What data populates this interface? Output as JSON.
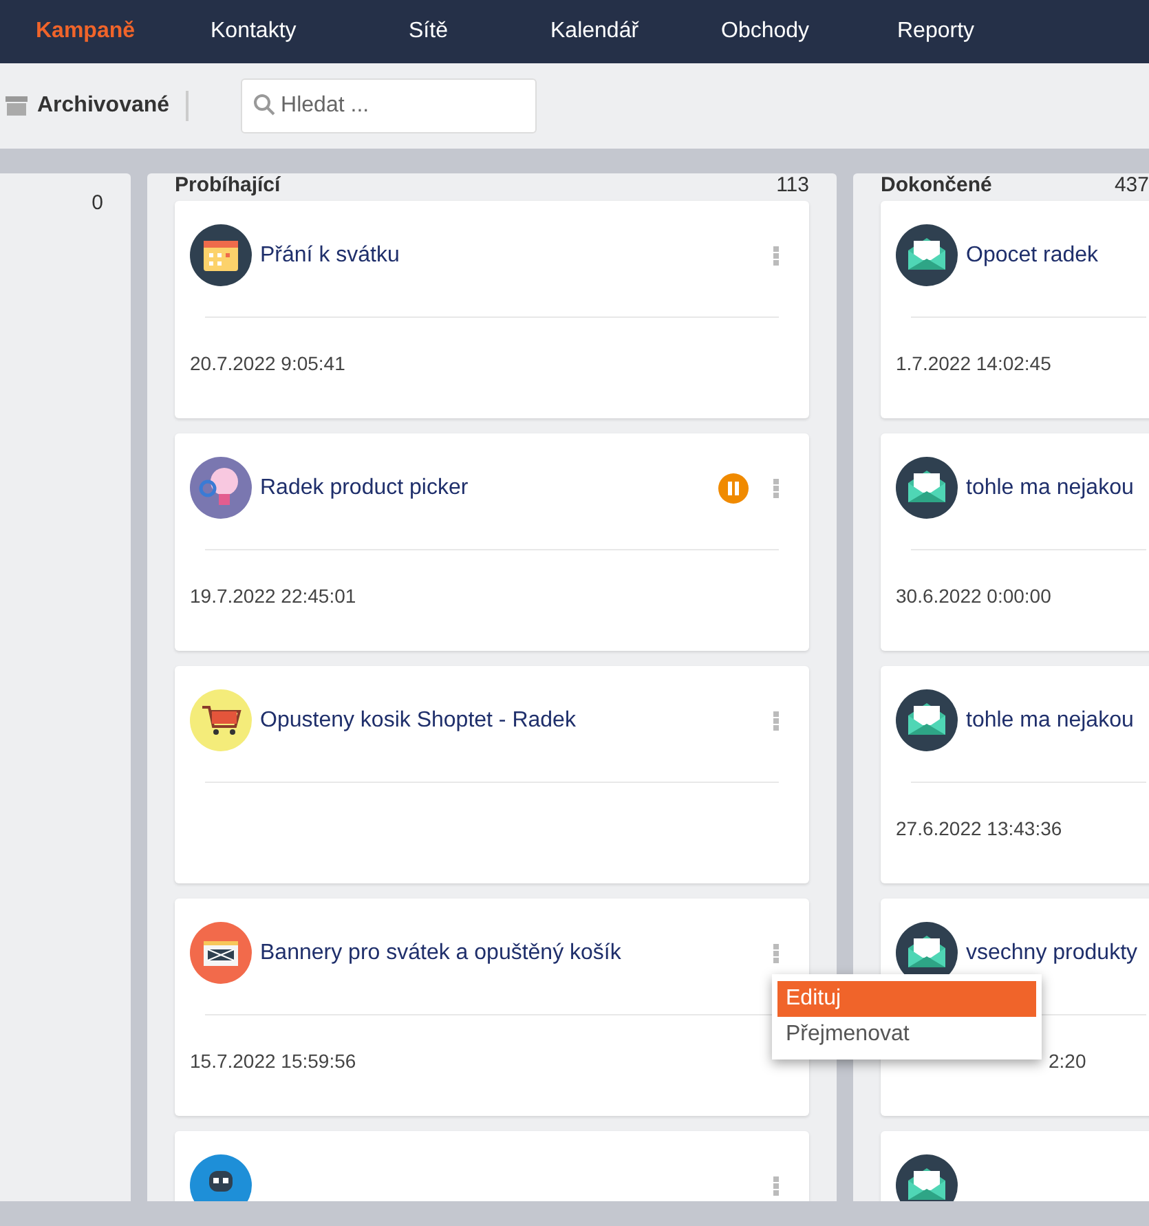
{
  "nav": [
    {
      "label": "Kampaně",
      "selected": true
    },
    {
      "label": "Kontakty",
      "selected": false
    },
    {
      "label": "Sítě",
      "selected": false
    },
    {
      "label": "Kalendář",
      "selected": false
    },
    {
      "label": "Obchody",
      "selected": false
    },
    {
      "label": "Reporty",
      "selected": false
    }
  ],
  "toolbar": {
    "archive_label": "Archivované",
    "search": {
      "placeholder": "Hledat ..."
    }
  },
  "columns": [
    {
      "count": "0"
    },
    {
      "title": "Probíhající",
      "count": "113",
      "cards": [
        {
          "title": "Přání k svátku",
          "date": "20.7.2022 9:05:41",
          "paused": false
        },
        {
          "title": "Radek product picker",
          "date": "19.7.2022 22:45:01",
          "paused": true
        },
        {
          "title": "Opusteny kosik Shoptet - Radek",
          "paused": false
        },
        {
          "title": "Bannery pro svátek a opuštěný košík",
          "date": "15.7.2022 15:59:56",
          "paused": false,
          "menu": [
            {
              "label": "Edituj",
              "selected": true
            },
            {
              "label": "Přejmenovat",
              "selected": false
            }
          ]
        },
        {
          "paused": false
        }
      ]
    },
    {
      "title": "Dokončené",
      "count": "437",
      "cards": [
        {
          "title": "Opocet radek",
          "date": "1.7.2022 14:02:45",
          "paused": false
        },
        {
          "title": "tohle ma nejakou",
          "date": "30.6.2022 0:00:00",
          "paused": false
        },
        {
          "title": "tohle ma nejakou",
          "date": "27.6.2022 13:43:36",
          "paused": false
        },
        {
          "title": "vsechny produkty",
          "date": "2:20",
          "date_covered": true,
          "paused": false
        },
        {
          "paused": false
        }
      ]
    }
  ]
}
